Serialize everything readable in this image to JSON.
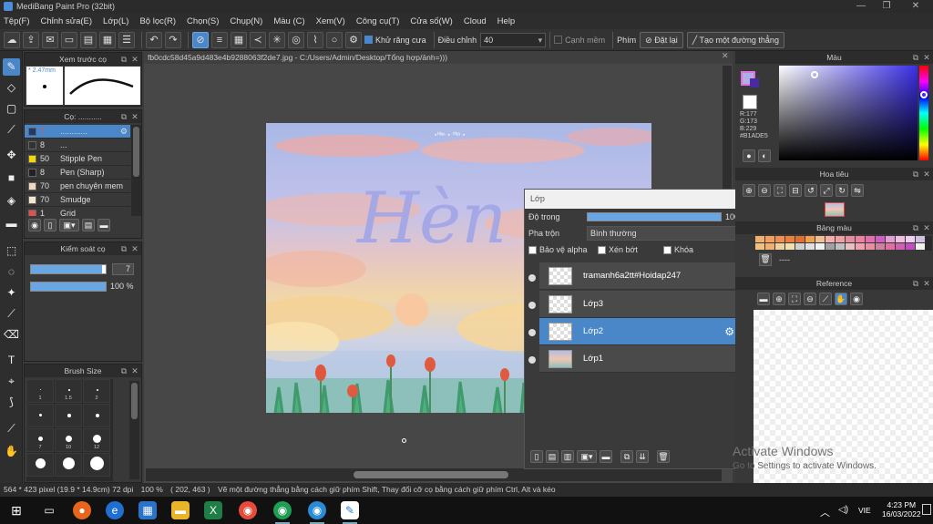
{
  "window": {
    "title": "MediBang Paint Pro (32bit)",
    "minimize": "—",
    "maximize": "❐",
    "close": "✕"
  },
  "menu": [
    "Tệp(F)",
    "Chỉnh sửa(E)",
    "Lớp(L)",
    "Bộ lọc(R)",
    "Chọn(S)",
    "Chụp(N)",
    "Màu (C)",
    "Xem(V)",
    "Công cụ(T)",
    "Cửa số(W)",
    "Cloud",
    "Help"
  ],
  "toolbar": {
    "antialias_label": "Khử răng cưa",
    "adjust_label": "Điều chỉnh",
    "adjust_value": "40",
    "edge_label": "Cạnh mềm",
    "shortcut_label": "Phím",
    "reset_label": "Đặt lại",
    "create_line_label": "Tạo một đường thẳng"
  },
  "preview_panel": {
    "title": "Xem trước cọ",
    "size": "2.47mm"
  },
  "brush_panel": {
    "title": "Cọ: ...........",
    "brushes": [
      {
        "size": "7",
        "name": "............",
        "color": "#1e3a6e",
        "selected": true
      },
      {
        "size": "8",
        "name": "...",
        "color": "#333333"
      },
      {
        "size": "50",
        "name": "Stipple Pen",
        "color": "#f5d800"
      },
      {
        "size": "8",
        "name": "Pen (Sharp)",
        "color": "#222222"
      },
      {
        "size": "70",
        "name": "pen chuyên mem",
        "color": "#f0d7c0"
      },
      {
        "size": "70",
        "name": "Smudge",
        "color": "#f5e6d0"
      },
      {
        "size": "1",
        "name": "Grid",
        "color": "#e05050"
      }
    ]
  },
  "brush_control": {
    "title": "Kiểm soát cọ",
    "size_value": "7",
    "opacity_value": "100 %",
    "size_fraction": 0.95,
    "opacity_fraction": 1.0
  },
  "brush_size": {
    "title": "Brush Size",
    "cells": [
      "1",
      "1.5",
      "2",
      "",
      "",
      "",
      "7",
      "10",
      "12"
    ]
  },
  "document": {
    "tab": "fb0cdc58d45a9d483e4b9288063f2de7.jpg - C:/Users/Admin/Desktop/Tổng hợp/ảnh=)))",
    "art_text": "Hèn",
    "art_small_text": "⋆ᴴᵃⁿ ⋆ ⁰ʰᵃ ⋆"
  },
  "layer_panel": {
    "title": "Lớp",
    "opacity_label": "Độ trong",
    "opacity_value": "100 %",
    "opacity_fraction": 1.0,
    "blend_label": "Pha trộn",
    "blend_value": "Bình thường",
    "protect_alpha": "Bảo vệ alpha",
    "clip": "Xén bớt",
    "lock": "Khóa",
    "layers": [
      {
        "name": "tramanh6a2tt#Hoidap247",
        "selected": false
      },
      {
        "name": "Lớp3",
        "selected": false
      },
      {
        "name": "Lớp2",
        "selected": true
      },
      {
        "name": "Lớp1",
        "selected": false
      }
    ]
  },
  "color_panel": {
    "title": "Màu",
    "r": "R:177",
    "g": "G:173",
    "b": "B:229",
    "hex": "#B1ADE5",
    "main_color": "#b1ade5"
  },
  "navigator": {
    "title": "Hoa tiêu"
  },
  "palette": {
    "title": "Bảng màu",
    "label": "----",
    "colors": [
      "#f0b070",
      "#f0a060",
      "#f09050",
      "#e88040",
      "#e07030",
      "#f0a050",
      "#f0c090",
      "#f0b0b0",
      "#f0a0a0",
      "#e090a0",
      "#f080a0",
      "#e070b0",
      "#d060c0",
      "#e0a0d0",
      "#f0c0e0",
      "#f0d0f0",
      "#d0c0e0",
      "#f0c080",
      "#f0b070",
      "#f0d0a0",
      "#f0e0b0",
      "#d0d0d0",
      "#e0e0e0",
      "#f0f0f0",
      "#a0a0a0",
      "#c0c0c0",
      "#e8c0c0",
      "#f0a0b0",
      "#e890a0",
      "#d080a0",
      "#e070a0",
      "#d060b0",
      "#c050c0",
      "#f0f0f0"
    ]
  },
  "reference": {
    "title": "Reference"
  },
  "status": {
    "dims": "564 * 423 pixel",
    "size_cm": "(19.9 * 14.9cm)",
    "dpi": "72 dpi",
    "zoom": "100 %",
    "coords": "( 202, 463 )",
    "hint": "Vẽ một đường thẳng bằng cách giữ phím Shift, Thay đổi cỡ cọ bằng cách giữ phím Ctrl, Alt và kéo"
  },
  "activation": {
    "line1": "Activate Windows",
    "line2": "Go to Settings to activate Windows."
  },
  "taskbar": {
    "time": "4:23 PM",
    "date": "16/03/2022",
    "lang": "VIE"
  }
}
